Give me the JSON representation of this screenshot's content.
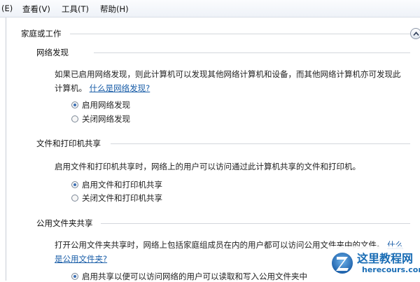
{
  "menubar": {
    "items": [
      "(E)",
      "查看(V)",
      "工具(T)",
      "帮助(H)"
    ]
  },
  "group": {
    "title": "家庭或工作"
  },
  "sections": [
    {
      "title": "网络发现",
      "description_line1": "如果已启用网络发现，则此计算机可以发现其他网络计算机和设备，而其他网络计算机亦可发现此",
      "description_line2": "计算机。",
      "link": "什么是网络发现?",
      "options": [
        "启用网络发现",
        "关闭网络发现"
      ],
      "selected": 0
    },
    {
      "title": "文件和打印机共享",
      "description": "启用文件和打印机共享时，网络上的用户可以访问通过此计算机共享的文件和打印机。",
      "options": [
        "启用文件和打印机共享",
        "关闭文件和打印机共享"
      ],
      "selected": 0
    },
    {
      "title": "公用文件夹共享",
      "description_line1": "打开公用文件夹共享时，网络上包括家庭组成员在内的用户都可以访问公用文件夹中的文件。",
      "link_line1": "什么",
      "link_line2": "是公用文件夹?",
      "options": [
        "启用共享以便可以访问网络的用户可以读取和写入公用文件夹中"
      ],
      "selected": 0
    }
  ],
  "watermark": {
    "title": "这里教程网",
    "subtitle": "herecours.com"
  },
  "colors": {
    "link": "#1a5ea8",
    "radio_dot": "#3b6fb4",
    "watermark": "#1a6db5"
  },
  "icons": {
    "collapse": "chevron-up-icon",
    "watermark_logo": "z-logo-icon"
  }
}
